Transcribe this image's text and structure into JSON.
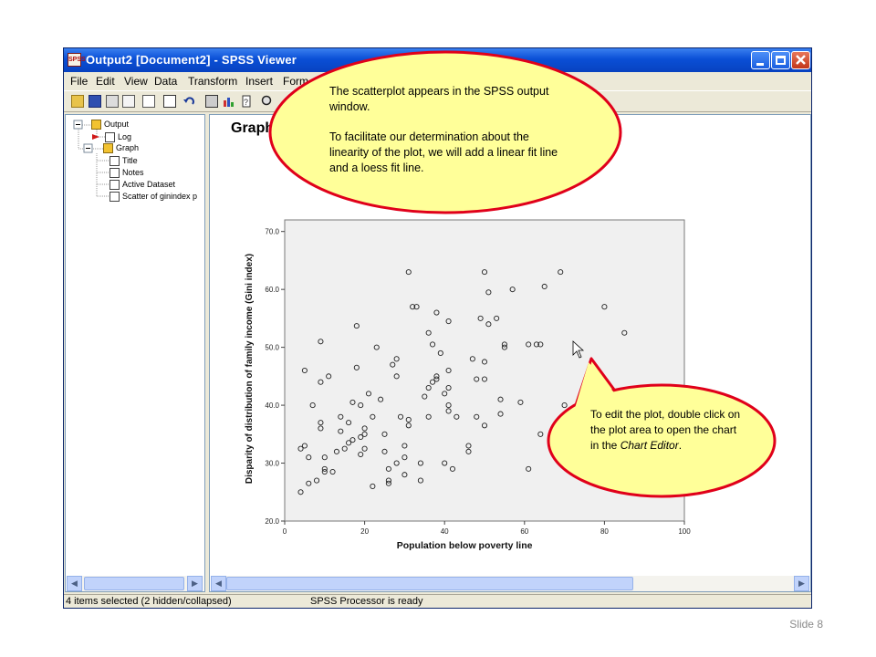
{
  "window": {
    "title": "Output2 [Document2] - SPSS Viewer",
    "app_icon": "SPSS"
  },
  "menu": [
    "File",
    "Edit",
    "View",
    "Data",
    "Transform",
    "Insert",
    "Form"
  ],
  "tree": {
    "output": "Output",
    "log": "Log",
    "graph": "Graph",
    "title": "Title",
    "notes": "Notes",
    "dataset": "Active Dataset",
    "scatter": "Scatter of ginindex p"
  },
  "content": {
    "heading": "Graph"
  },
  "status": {
    "left": "4 items selected (2 hidden/collapsed)",
    "processor": "SPSS Processor  is ready"
  },
  "callout_top": {
    "line1": "The scatterplot appears in the SPSS output window.",
    "line2": "To facilitate our determination about the linearity of the plot, we will add a linear fit line and a loess fit line."
  },
  "callout_bottom": {
    "text": "To edit the plot, double click on the plot area to open the chart in the",
    "emph": "Chart Editor",
    "tail": "."
  },
  "slide": "Slide 8",
  "colors": {
    "callout_fill": "#ffff99",
    "callout_border": "#e0001a",
    "plot_bg": "#f0f0f0"
  },
  "chart_data": {
    "type": "scatter",
    "xlabel": "Population below poverty line",
    "ylabel": "Disparity of distribution of family income (Gini index)",
    "xlim": [
      0,
      100
    ],
    "ylim": [
      20,
      72
    ],
    "xticks": [
      "0",
      "20",
      "40",
      "60",
      "80",
      "100"
    ],
    "yticks": [
      "20.0",
      "30.0",
      "40.0",
      "50.0",
      "60.0",
      "70.0"
    ],
    "points": [
      [
        4,
        25
      ],
      [
        4,
        32.5
      ],
      [
        5,
        33
      ],
      [
        5,
        46
      ],
      [
        6,
        31
      ],
      [
        6,
        26.5
      ],
      [
        7,
        40
      ],
      [
        8,
        27
      ],
      [
        9,
        36
      ],
      [
        9,
        37
      ],
      [
        9,
        51
      ],
      [
        9,
        44
      ],
      [
        10,
        31
      ],
      [
        10,
        29
      ],
      [
        10,
        28.5
      ],
      [
        11,
        45
      ],
      [
        12,
        28.5
      ],
      [
        13,
        32
      ],
      [
        14,
        38
      ],
      [
        14,
        35.5
      ],
      [
        15,
        32.5
      ],
      [
        16,
        33.5
      ],
      [
        16,
        37
      ],
      [
        17,
        34
      ],
      [
        17,
        40.5
      ],
      [
        18,
        46.5
      ],
      [
        18,
        53.7
      ],
      [
        19,
        40
      ],
      [
        19,
        34.5
      ],
      [
        19,
        31.5
      ],
      [
        20,
        35
      ],
      [
        20,
        32.5
      ],
      [
        20,
        36
      ],
      [
        21,
        42
      ],
      [
        22,
        38
      ],
      [
        22,
        26
      ],
      [
        23,
        50
      ],
      [
        24,
        41
      ],
      [
        25,
        35
      ],
      [
        25,
        32
      ],
      [
        26,
        29
      ],
      [
        26,
        27
      ],
      [
        26,
        26.5
      ],
      [
        27,
        47
      ],
      [
        28,
        30
      ],
      [
        28,
        45
      ],
      [
        28,
        48
      ],
      [
        29,
        38
      ],
      [
        30,
        31
      ],
      [
        30,
        28
      ],
      [
        30,
        33
      ],
      [
        31,
        36.5
      ],
      [
        31,
        37.5
      ],
      [
        31,
        63
      ],
      [
        32,
        57
      ],
      [
        33,
        57
      ],
      [
        34,
        30
      ],
      [
        34,
        27
      ],
      [
        35,
        41.5
      ],
      [
        36,
        43
      ],
      [
        36,
        52.5
      ],
      [
        36,
        38
      ],
      [
        37,
        44
      ],
      [
        37,
        50.5
      ],
      [
        38,
        44.5
      ],
      [
        38,
        45
      ],
      [
        38,
        56
      ],
      [
        39,
        49
      ],
      [
        40,
        42
      ],
      [
        40,
        30
      ],
      [
        41,
        40
      ],
      [
        41,
        39
      ],
      [
        41,
        43
      ],
      [
        41,
        46
      ],
      [
        41,
        54.5
      ],
      [
        42,
        29
      ],
      [
        43,
        38
      ],
      [
        46,
        33
      ],
      [
        46,
        32
      ],
      [
        47,
        48
      ],
      [
        48,
        38
      ],
      [
        48,
        44.5
      ],
      [
        49,
        55
      ],
      [
        50,
        36.5
      ],
      [
        50,
        63
      ],
      [
        50,
        44.5
      ],
      [
        50,
        47.5
      ],
      [
        51,
        59.5
      ],
      [
        51,
        54
      ],
      [
        53,
        55
      ],
      [
        54,
        38.5
      ],
      [
        54,
        41
      ],
      [
        55,
        50.5
      ],
      [
        55,
        50
      ],
      [
        57,
        60
      ],
      [
        59,
        40.5
      ],
      [
        61,
        29
      ],
      [
        61,
        50.5
      ],
      [
        63,
        50.5
      ],
      [
        64,
        50.5
      ],
      [
        64,
        35
      ],
      [
        65,
        60.5
      ],
      [
        68,
        33.5
      ],
      [
        69,
        63
      ],
      [
        70,
        40
      ],
      [
        80,
        57
      ],
      [
        85,
        52.5
      ]
    ]
  }
}
